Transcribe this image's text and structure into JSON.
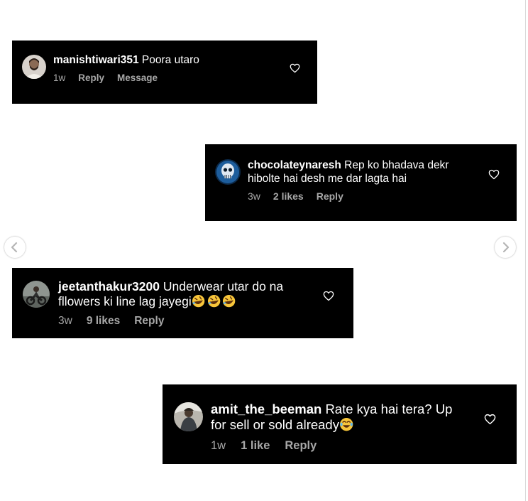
{
  "comments": [
    {
      "username": "manishtiwari351",
      "text": "Poora utaro",
      "time": "1w",
      "likes": "",
      "reply_label": "Reply",
      "message_label": "Message",
      "avatar_icon": "user-avatar-man"
    },
    {
      "username": "chocolateynaresh",
      "text": "Rep ko bhadava  dekr\nhibolte hai desh me dar lagta hai",
      "time": "3w",
      "likes": "2 likes",
      "reply_label": "Reply",
      "avatar_icon": "user-avatar-skull"
    },
    {
      "username": "jeetanthakur3200",
      "text": "Underwear utar do na\nfllowers ki line lag jayegi",
      "emoji": "rolling-laughing-emoji",
      "time": "3w",
      "likes": "9 likes",
      "reply_label": "Reply",
      "avatar_icon": "user-avatar-bike"
    },
    {
      "username": "amit_the_beeman",
      "text": "Rate kya hai tera? Up\nfor sell or sold already",
      "emoji": "tears-of-joy-emoji",
      "time": "1w",
      "likes": "1 like",
      "reply_label": "Reply",
      "avatar_icon": "user-avatar-person"
    }
  ],
  "icons": {
    "like": "heart-outline-icon",
    "prev": "chevron-left-icon",
    "next": "chevron-right-icon"
  },
  "colors": {
    "card_background": "#000000",
    "text_primary": "#ffffff",
    "text_secondary": "#a8a8a8",
    "page_background": "#ffffff"
  }
}
